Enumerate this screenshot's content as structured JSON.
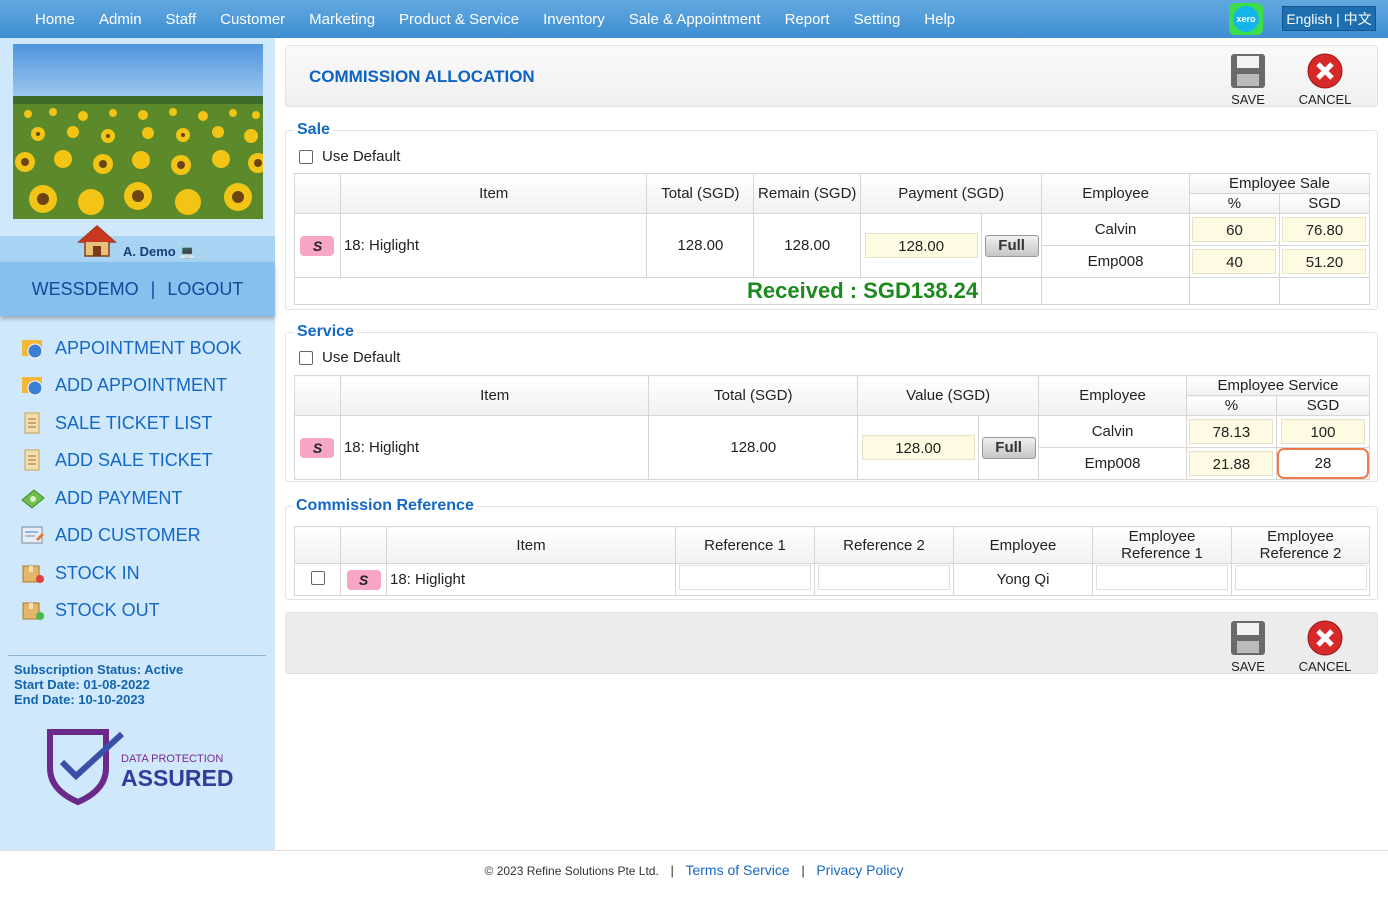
{
  "nav": {
    "items": [
      "Home",
      "Admin",
      "Staff",
      "Customer",
      "Marketing",
      "Product & Service",
      "Inventory",
      "Sale & Appointment",
      "Report",
      "Setting",
      "Help"
    ],
    "xero": "xero",
    "language": "English | 中文"
  },
  "sidebar": {
    "username": "A. Demo",
    "account": "WESSDEMO",
    "logout": "LOGOUT",
    "items": [
      {
        "label": "APPOINTMENT BOOK",
        "icon": "appointment-book-icon"
      },
      {
        "label": "ADD APPOINTMENT",
        "icon": "add-appointment-icon"
      },
      {
        "label": "SALE TICKET LIST",
        "icon": "sale-ticket-list-icon"
      },
      {
        "label": "ADD SALE TICKET",
        "icon": "add-sale-ticket-icon"
      },
      {
        "label": "ADD PAYMENT",
        "icon": "add-payment-icon"
      },
      {
        "label": "ADD CUSTOMER",
        "icon": "add-customer-icon"
      },
      {
        "label": "STOCK IN",
        "icon": "stock-in-icon"
      },
      {
        "label": "STOCK OUT",
        "icon": "stock-out-icon"
      }
    ],
    "subscription_status": "Subscription Status: Active",
    "start_date": "Start Date: 01-08-2022",
    "end_date": "End Date: 10-10-2023",
    "badge_line1": "DATA PROTECTION",
    "badge_line2": "ASSURED"
  },
  "page": {
    "title": "COMMISSION ALLOCATION",
    "save": "SAVE",
    "cancel": "CANCEL"
  },
  "sale": {
    "title": "Sale",
    "use_default": "Use Default",
    "headers": {
      "item": "Item",
      "total": "Total (SGD)",
      "remain": "Remain (SGD)",
      "payment": "Payment (SGD)",
      "employee": "Employee",
      "emp_sale": "Employee Sale",
      "pct": "%",
      "sgd": "SGD"
    },
    "row": {
      "badge": "S",
      "item": "18: Higlight",
      "total": "128.00",
      "remain": "128.00",
      "payment": "128.00",
      "full": "Full"
    },
    "employees": [
      {
        "name": "Calvin",
        "pct": "60",
        "sgd": "76.80"
      },
      {
        "name": "Emp008",
        "pct": "40",
        "sgd": "51.20"
      }
    ],
    "received": "Received : SGD138.24"
  },
  "service": {
    "title": "Service",
    "use_default": "Use Default",
    "headers": {
      "item": "Item",
      "total": "Total (SGD)",
      "value": "Value (SGD)",
      "employee": "Employee",
      "emp_service": "Employee Service",
      "pct": "%",
      "sgd": "SGD"
    },
    "row": {
      "badge": "S",
      "item": "18: Higlight",
      "total": "128.00",
      "value": "128.00",
      "full": "Full"
    },
    "employees": [
      {
        "name": "Calvin",
        "pct": "78.13",
        "sgd": "100"
      },
      {
        "name": "Emp008",
        "pct": "21.88",
        "sgd": "28"
      }
    ]
  },
  "reference": {
    "title": "Commission Reference",
    "headers": {
      "item": "Item",
      "ref1": "Reference 1",
      "ref2": "Reference 2",
      "employee": "Employee",
      "emp_ref1_a": "Employee",
      "emp_ref1_b": "Reference 1",
      "emp_ref2_a": "Employee",
      "emp_ref2_b": "Reference 2"
    },
    "row": {
      "badge": "S",
      "item": "18: Higlight",
      "employee": "Yong Qi"
    }
  },
  "footer": {
    "copyright": "© 2023 Refine Solutions Pte Ltd.",
    "terms": "Terms of Service",
    "privacy": "Privacy Policy"
  },
  "colors": {
    "nav": "#3f8fd2",
    "sidebar": "#cfe8fb",
    "accent": "#1468c4",
    "received": "#1c8a1c",
    "focus": "#f0784a"
  }
}
